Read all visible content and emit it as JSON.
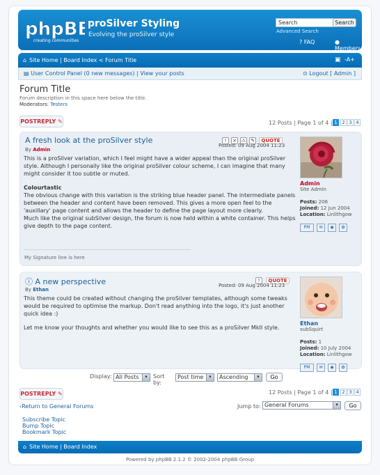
{
  "header": {
    "logo_text": "phpBB",
    "logo_tagline": "creating communities",
    "site_title": "proSilver Styling",
    "site_description": "Evolving the proSilver style",
    "search_value": "Search",
    "search_button": "Search",
    "advanced_search": "Advanced Search",
    "faq": "FAQ",
    "members": "Members"
  },
  "nav": {
    "crumbs": "Site Home | Board Index < Forum Title",
    "font_control": "-A+"
  },
  "user_bar": {
    "ucp": "User Control Panel",
    "messages": "(0 new messages)",
    "view_posts": "View your posts",
    "logout": "Logout [ Admin ]"
  },
  "forum": {
    "title": "Forum Title",
    "description": "Forum description in this space here below the title.",
    "moderators_label": "Moderators:",
    "moderators": "Testers"
  },
  "actions": {
    "post_reply": "POSTREPLY",
    "page_text": "12 Posts | Page 1 of 4 |",
    "pages": [
      "1",
      "2",
      "3",
      "4"
    ]
  },
  "posts": [
    {
      "title": "A fresh look at the proSilver style",
      "by_label": "By",
      "author": "Admin",
      "posted": "Posted: 09 Aug 2004 11:23",
      "quote": "QUOTE",
      "body": [
        "This is a proSilver variation, which I feel might have a wider appeal than the original proSilver style. Although I personally like the original proSilver colour scheme, I can imagine that many might consider it too subtle or muted.",
        "Colourtastic",
        "The obvious change with this variation is the striking blue header panel. The intermediate panels between the header and content have been removed. This gives a more open feel to the 'auxillary' page content and allows the header to define the page layout more clearly.",
        "Much like the original subSilver design, the forum is now held within a white container. This helps give depth to the page content."
      ],
      "signature": "My Signature line is here",
      "profile": {
        "name": "Admin",
        "rank": "Site Admin",
        "posts_label": "Posts:",
        "posts": "206",
        "joined_label": "Joined:",
        "joined": "12 Jun 2004",
        "location_label": "Location:",
        "location": "Linlithgow"
      }
    },
    {
      "title": "A new perspective",
      "by_label": "By",
      "author": "Ethan",
      "posted": "Posted: 09 Aug 2004 11:23",
      "quote": "QUOTE",
      "body": [
        "This theme could be created without changing the proSilver templates, although some tweaks would be required to optimise the markup. Don't read anything into the logo, it's just another quick idea :)",
        "Let me know your thoughts and whether you would like to see this as a proSilver MkII style."
      ],
      "profile": {
        "name": "Ethan",
        "rank": "subSquirt",
        "posts_label": "Posts:",
        "posts": "1",
        "joined_label": "Joined:",
        "joined": "10 July 2004",
        "location_label": "Location:",
        "location": "Linlithgow"
      }
    }
  ],
  "display": {
    "display_label": "Display:",
    "display_value": "All Posts",
    "sort_label": "Sort by:",
    "sort_value": "Post time",
    "order_value": "Ascending",
    "go": "Go"
  },
  "bottom": {
    "return_link": "Return to General Forums",
    "jump_label": "Jump to:",
    "jump_value": "General Forums",
    "go": "Go",
    "topic_links": [
      "Subscribe Topic",
      "Bump Topic",
      "Bookmark Topic"
    ],
    "footer_crumbs": "Site Home | Board Index",
    "copyright": "Powered by phpBB 2.1.2 © 2002-2004 phpBB Group"
  },
  "colors": {
    "header_blue": "#1a8fd3",
    "link_blue": "#1a5f9a",
    "admin_red": "#c1001f"
  }
}
